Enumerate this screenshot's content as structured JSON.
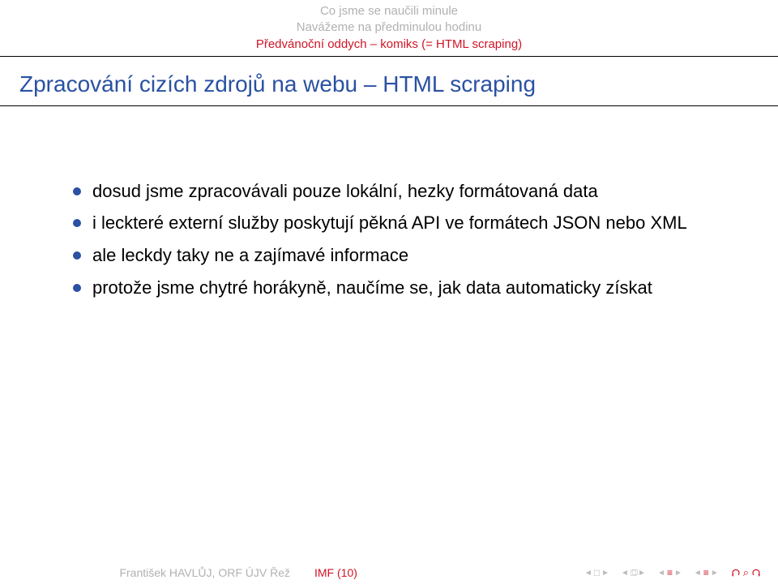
{
  "breadcrumbs": {
    "line1": "Co jsme se naučili minule",
    "line2": "Navážeme na předminulou hodinu",
    "line3": "Předvánoční oddych – komiks (= HTML scraping)"
  },
  "frametitle": "Zpracování cizích zdrojů na webu – HTML scraping",
  "bullets": [
    "dosud jsme zpracovávali pouze lokální, hezky formátovaná data",
    "i leckteré externí služby poskytují pěkná API ve formátech JSON nebo XML",
    "ale leckdy taky ne a zajímavé informace",
    "protože jsme chytré horákyně, naučíme se, jak data automaticky získat"
  ],
  "footer": {
    "author": "František HAVLŮJ, ORF ÚJV Řež",
    "shorttitle": "IMF (10)"
  }
}
